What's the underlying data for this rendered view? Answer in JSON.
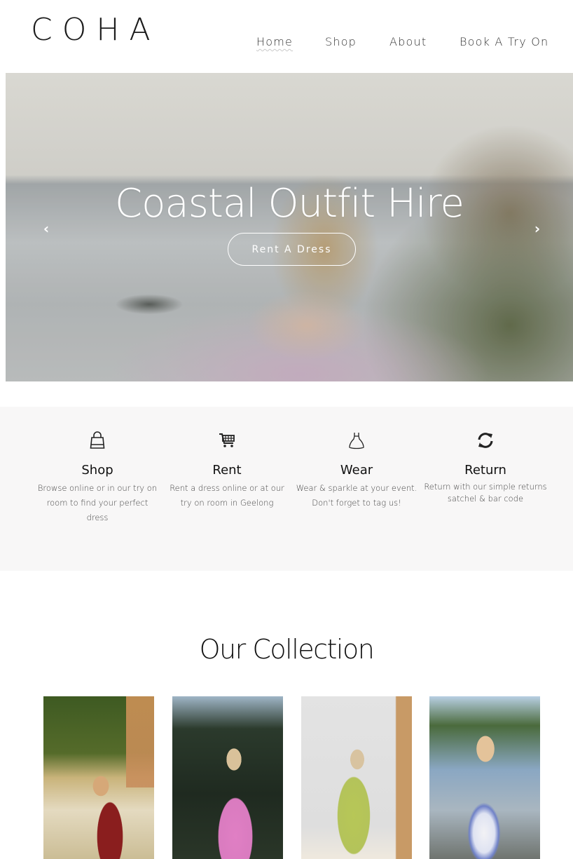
{
  "header": {
    "logo": "COHA",
    "nav": [
      {
        "label": "Home",
        "active": true
      },
      {
        "label": "Shop",
        "active": false
      },
      {
        "label": "About",
        "active": false
      },
      {
        "label": "Book A Try On",
        "active": false
      }
    ]
  },
  "hero": {
    "title": "Coastal Outfit Hire",
    "button_label": "Rent A Dress",
    "prev_icon": "chevron-left-icon",
    "next_icon": "chevron-right-icon",
    "prev_glyph": "‹",
    "next_glyph": "›"
  },
  "features": [
    {
      "icon": "shopping-bag-icon",
      "title": "Shop",
      "description": "Browse online or in our try on room to find your perfect dress"
    },
    {
      "icon": "shopping-cart-icon",
      "title": "Rent",
      "description": "Rent a dress online or at our try on room in Geelong"
    },
    {
      "icon": "dress-icon",
      "title": "Wear",
      "description": "Wear & sparkle at your event. Don't forget to tag us!"
    },
    {
      "icon": "refresh-icon",
      "title": "Return",
      "description": "Return with our simple returns satchel & bar code"
    }
  ],
  "collection": {
    "title": "Our Collection",
    "items": [
      {
        "image": "red-floral-slip-dress-street-photo"
      },
      {
        "image": "pink-maxi-shirt-dress-palms-photo"
      },
      {
        "image": "lime-pleated-set-mirror-selfie-photo"
      },
      {
        "image": "blue-white-floral-cutout-dress-photo"
      }
    ]
  },
  "colors": {
    "feature_band": "#f8f7f7",
    "text": "#1a1a1a",
    "hero_text": "#ffffff"
  }
}
